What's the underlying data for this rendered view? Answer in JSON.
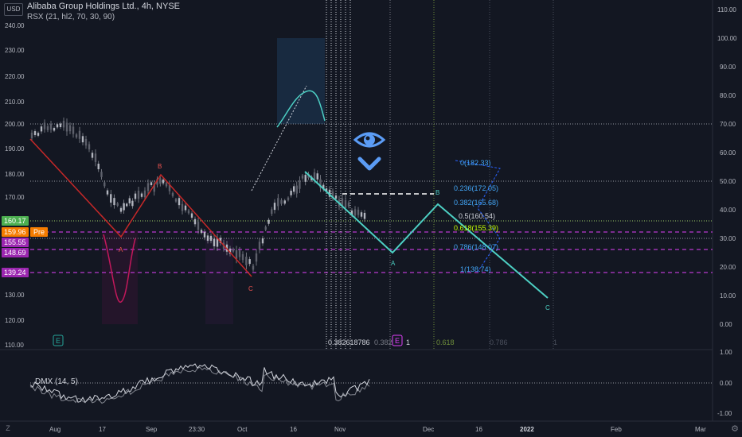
{
  "header": {
    "currency": "USD",
    "title": "Alibaba Group Holdings Ltd., 4h, NYSE",
    "indicator": "RSX (21, hl2, 70, 30, 90)"
  },
  "lower_pane": {
    "indicator": "DMX (14, 5)"
  },
  "left_axis_labels": [
    "240.00",
    "230.00",
    "220.00",
    "210.00",
    "200.00",
    "190.00",
    "180.00",
    "170.00",
    "130.00",
    "120.00",
    "110.00"
  ],
  "right_axis_labels": [
    "110.00",
    "100.00",
    "90.00",
    "80.00",
    "70.00",
    "60.00",
    "50.00",
    "40.00",
    "30.00",
    "20.00",
    "10.00",
    "0.00"
  ],
  "lower_right_labels": [
    "1.00",
    "0.00",
    "-1.00"
  ],
  "time_labels": [
    "Aug",
    "17",
    "Sep",
    "23:30",
    "Oct",
    "16",
    "Nov",
    "Dec",
    "16",
    "2022",
    "Feb",
    "Mar"
  ],
  "price_badges": [
    {
      "text": "160.17",
      "color": "#4caf50"
    },
    {
      "text": "159.96",
      "color": "#f57c00"
    },
    {
      "text": "155.55",
      "color": "#9c27b0"
    },
    {
      "text": "148.69",
      "color": "#9c27b0"
    },
    {
      "text": "139.24",
      "color": "#9c27b0"
    }
  ],
  "pre_label": "Pre",
  "fib_levels": [
    {
      "text": "0(182.33)"
    },
    {
      "text": "0.236(172.05)"
    },
    {
      "text": "0.382(165.68)"
    },
    {
      "text": "0.5(160.54)"
    },
    {
      "text": "0.618(155.39)"
    },
    {
      "text": "0.786(148.07)"
    },
    {
      "text": "1(138.74)"
    }
  ],
  "wave_labels": [
    "A",
    "B",
    "C",
    "A",
    "B",
    "C"
  ],
  "time_fib_labels": {
    "cluster": "0.382618786",
    "mid": "0.382",
    "e_trail": "1",
    "golden": "0.618",
    "b": "0.786",
    "c": "1"
  },
  "earnings_marker": "E",
  "zoom_button": "Z",
  "colors": {
    "accent_teal": "#4dd0c4",
    "bear_red": "#c62828",
    "fib_blue": "#2962ff",
    "magenta": "#e040fb",
    "pink": "#c2185b"
  },
  "icons": [
    "eye-icon",
    "chevron-down-icon",
    "earnings-icon",
    "settings-icon"
  ]
}
